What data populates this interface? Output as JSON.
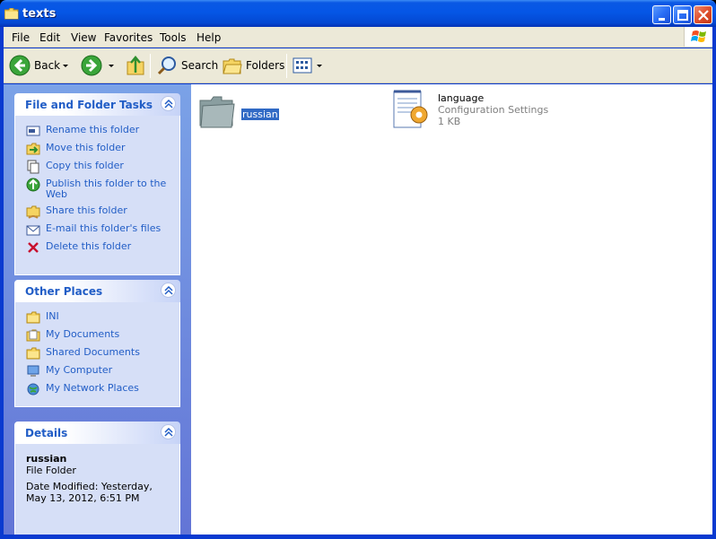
{
  "window": {
    "title": "texts"
  },
  "menu": {
    "file": "File",
    "edit": "Edit",
    "view": "View",
    "favorites": "Favorites",
    "tools": "Tools",
    "help": "Help"
  },
  "toolbar": {
    "back": "Back",
    "search": "Search",
    "folders": "Folders"
  },
  "tasks_panel": {
    "title": "File and Folder Tasks",
    "items": [
      {
        "label": "Rename this folder",
        "icon": "rename-icon"
      },
      {
        "label": "Move this folder",
        "icon": "move-icon"
      },
      {
        "label": "Copy this folder",
        "icon": "copy-icon"
      },
      {
        "label": "Publish this folder to the Web",
        "icon": "publish-web-icon"
      },
      {
        "label": "Share this folder",
        "icon": "share-icon"
      },
      {
        "label": "E-mail this folder's files",
        "icon": "email-icon"
      },
      {
        "label": "Delete this folder",
        "icon": "delete-icon"
      }
    ]
  },
  "places_panel": {
    "title": "Other Places",
    "items": [
      {
        "label": "INI",
        "icon": "folder-icon"
      },
      {
        "label": "My Documents",
        "icon": "my-documents-icon"
      },
      {
        "label": "Shared Documents",
        "icon": "folder-icon"
      },
      {
        "label": "My Computer",
        "icon": "my-computer-icon"
      },
      {
        "label": "My Network Places",
        "icon": "network-places-icon"
      }
    ]
  },
  "details_panel": {
    "title": "Details",
    "name": "russian",
    "type": "File Folder",
    "modified": "Date Modified: Yesterday, May 13, 2012, 6:51 PM"
  },
  "files": [
    {
      "name": "russian",
      "icon": "folder-icon",
      "selected": true
    },
    {
      "name": "language",
      "type": "Configuration Settings",
      "size": "1 KB",
      "icon": "config-file-icon"
    }
  ],
  "colors": {
    "titlebar": "#0556e6",
    "link": "#215dc6",
    "selection": "#316ac5",
    "pane": "#7ba2e7"
  }
}
